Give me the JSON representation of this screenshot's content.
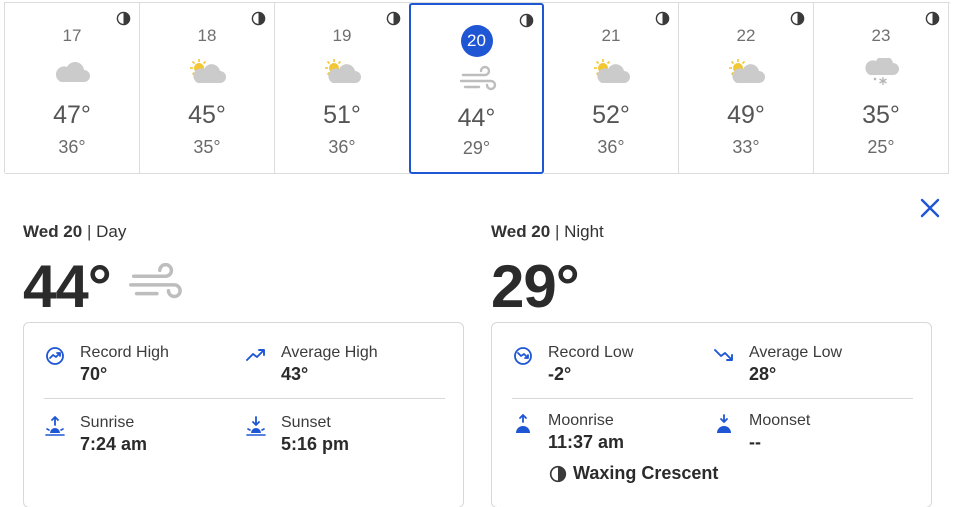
{
  "days": [
    {
      "date": "17",
      "hi": "47°",
      "lo": "36°",
      "icon": "cloud-icon",
      "selected": false
    },
    {
      "date": "18",
      "hi": "45°",
      "lo": "35°",
      "icon": "partly-sunny-icon",
      "selected": false
    },
    {
      "date": "19",
      "hi": "51°",
      "lo": "36°",
      "icon": "partly-sunny-icon",
      "selected": false
    },
    {
      "date": "20",
      "hi": "44°",
      "lo": "29°",
      "icon": "wind-icon",
      "selected": true
    },
    {
      "date": "21",
      "hi": "52°",
      "lo": "36°",
      "icon": "partly-sunny-icon",
      "selected": false
    },
    {
      "date": "22",
      "hi": "49°",
      "lo": "33°",
      "icon": "partly-sunny-icon",
      "selected": false
    },
    {
      "date": "23",
      "hi": "35°",
      "lo": "25°",
      "icon": "snow-cloud-icon",
      "selected": false
    }
  ],
  "colors": {
    "accent": "#1f56d4",
    "sun": "#f3c633",
    "cloud": "#c9c9c9"
  },
  "day_panel": {
    "date": "Wed 20",
    "part": "Day",
    "temp": "44°",
    "record_label": "Record High",
    "record_value": "70°",
    "average_label": "Average High",
    "average_value": "43°",
    "rise_label": "Sunrise",
    "rise_value": "7:24 am",
    "set_label": "Sunset",
    "set_value": "5:16 pm"
  },
  "night_panel": {
    "date": "Wed 20",
    "part": "Night",
    "temp": "29°",
    "record_label": "Record Low",
    "record_value": "-2°",
    "average_label": "Average Low",
    "average_value": "28°",
    "rise_label": "Moonrise",
    "rise_value": "11:37 am",
    "set_label": "Moonset",
    "set_value": "--",
    "phase": "Waxing Crescent"
  }
}
